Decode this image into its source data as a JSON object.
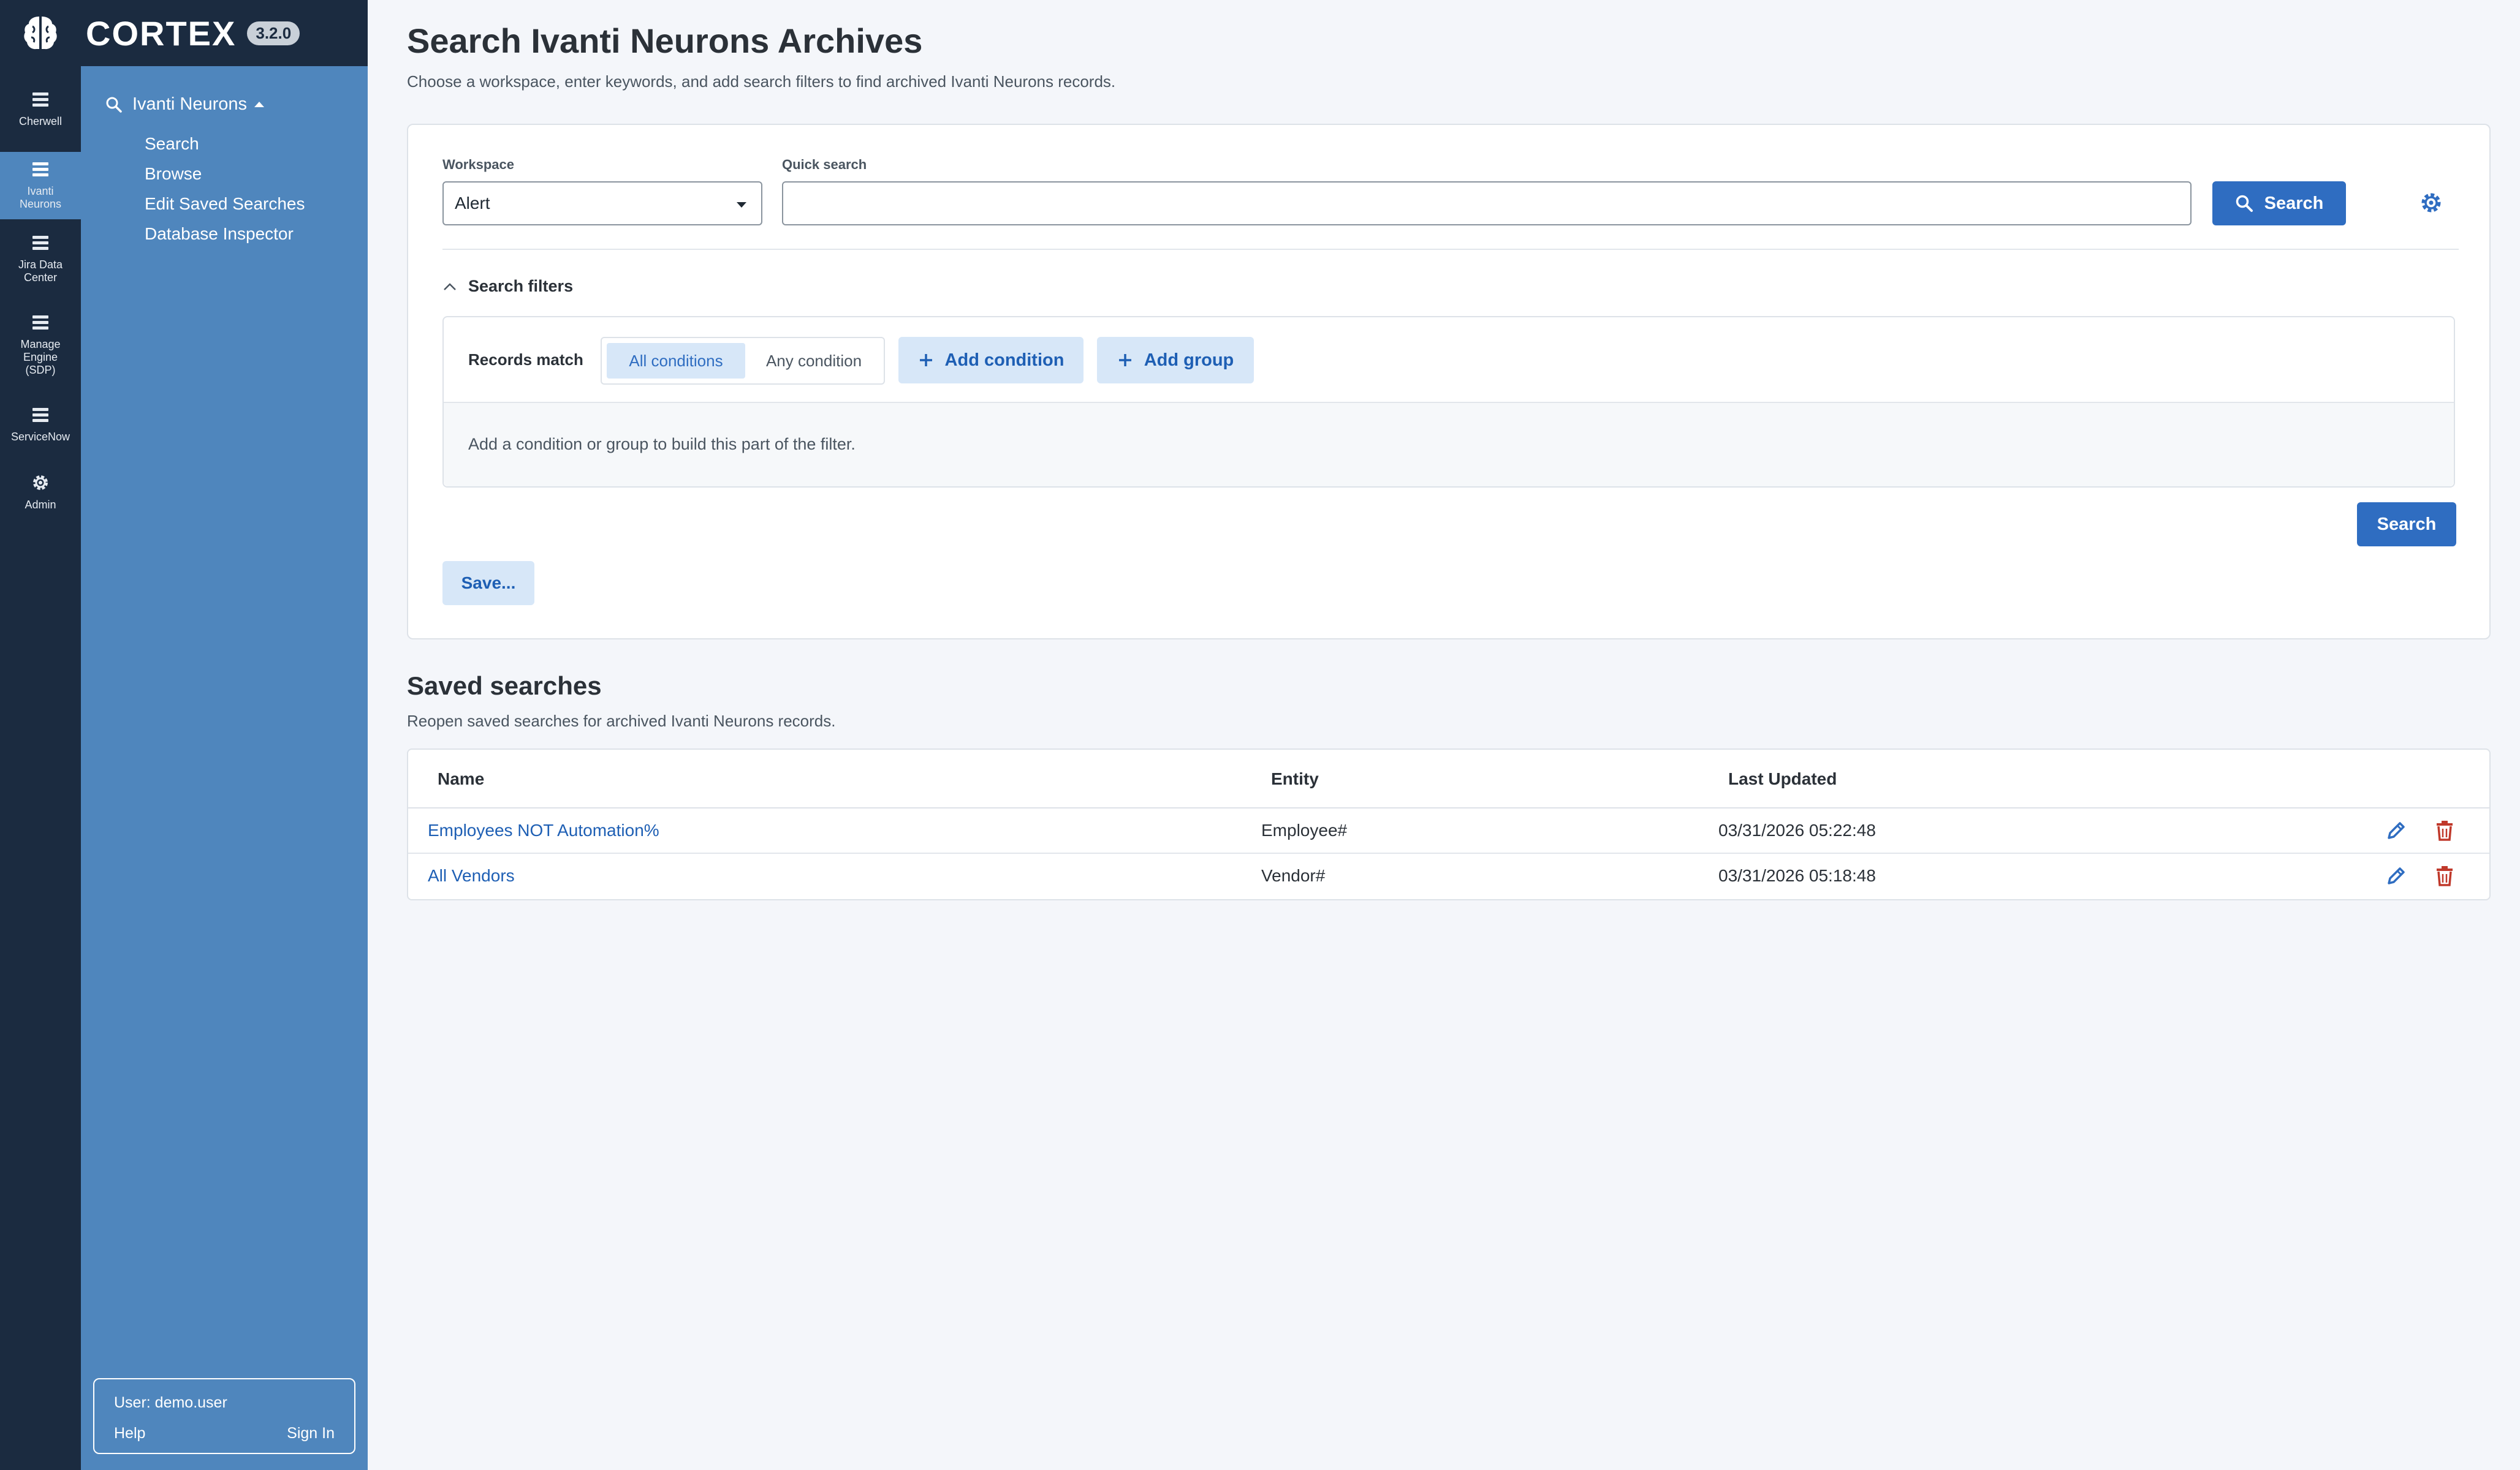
{
  "app": {
    "name": "CORTEX",
    "version": "3.2.0",
    "accent_color": "#2f6dc1",
    "sidebar_color": "#1b2b40",
    "subnav_color": "#4f86bd"
  },
  "rail": {
    "items": [
      {
        "label": "Cherwell",
        "icon": "list-icon"
      },
      {
        "label": "Ivanti\nNeurons",
        "icon": "list-icon",
        "active": true
      },
      {
        "label": "Jira Data\nCenter",
        "icon": "list-icon"
      },
      {
        "label": "Manage\nEngine\n(SDP)",
        "icon": "list-icon"
      },
      {
        "label": "ServiceNow",
        "icon": "list-icon"
      },
      {
        "label": "Admin",
        "icon": "gear-icon"
      }
    ]
  },
  "subnav": {
    "heading": "Ivanti Neurons",
    "links": [
      "Search",
      "Browse",
      "Edit Saved Searches",
      "Database Inspector"
    ]
  },
  "user": {
    "label": "User: demo.user",
    "help": "Help",
    "sign_in": "Sign In"
  },
  "page": {
    "title": "Search Ivanti Neurons Archives",
    "subtitle": "Choose a workspace, enter keywords, and add search filters to find archived Ivanti Neurons records."
  },
  "search": {
    "workspace_label": "Workspace",
    "workspace_value": "Alert",
    "quick_label": "Quick search",
    "quick_value": "",
    "search_button": "Search"
  },
  "filters": {
    "toggle_label": "Search filters",
    "records_match": "Records match",
    "all_conditions": "All conditions",
    "any_condition": "Any condition",
    "add_condition": "Add condition",
    "add_group": "Add group",
    "empty_message": "Add a condition or group to build this part of the filter.",
    "search_button": "Search",
    "save_button": "Save..."
  },
  "saved": {
    "title": "Saved searches",
    "subtitle": "Reopen saved searches for archived Ivanti Neurons records.",
    "columns": [
      "Name",
      "Entity",
      "Last Updated"
    ],
    "rows": [
      {
        "name": "Employees NOT Automation%",
        "entity": "Employee#",
        "updated": "03/31/2026 05:22:48"
      },
      {
        "name": "All Vendors",
        "entity": "Vendor#",
        "updated": "03/31/2026 05:18:48"
      }
    ]
  }
}
